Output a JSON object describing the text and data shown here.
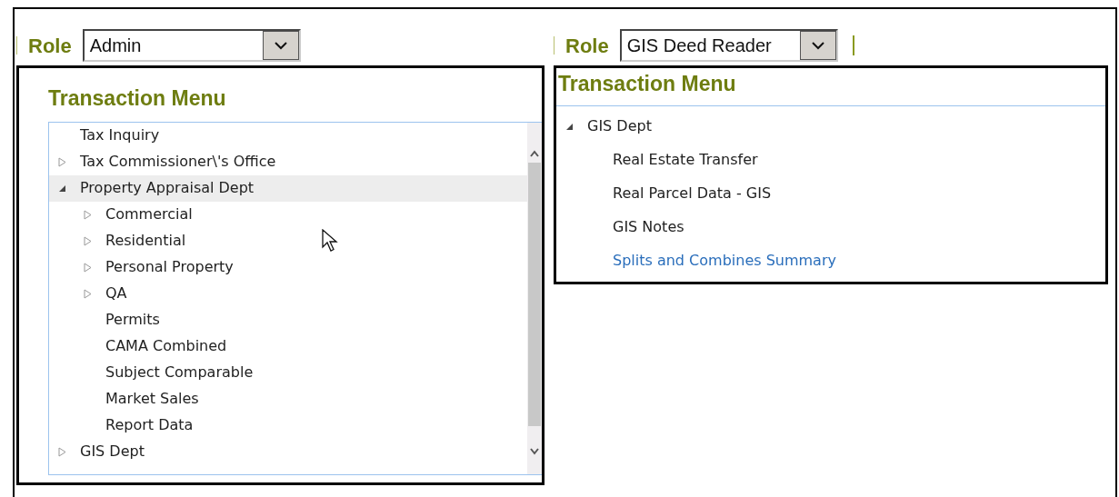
{
  "panels": [
    {
      "role": {
        "label": "Role",
        "value": "Admin"
      },
      "title": "Transaction Menu",
      "scrollbar": true,
      "items": [
        {
          "label": "Tax Inquiry",
          "kind": "leaf",
          "selected": false
        },
        {
          "label": "Tax Commissioner\\'s Office",
          "kind": "group",
          "expanded": false,
          "selected": false
        },
        {
          "label": "Property Appraisal Dept",
          "kind": "group",
          "expanded": true,
          "selected": true,
          "children": [
            {
              "label": "Commercial",
              "kind": "group",
              "expanded": false,
              "selected": false
            },
            {
              "label": "Residential",
              "kind": "group",
              "expanded": false,
              "selected": false
            },
            {
              "label": "Personal Property",
              "kind": "group",
              "expanded": false,
              "selected": false
            },
            {
              "label": "QA",
              "kind": "group",
              "expanded": false,
              "selected": false
            },
            {
              "label": "Permits",
              "kind": "leaf",
              "selected": false
            },
            {
              "label": "CAMA Combined",
              "kind": "leaf",
              "selected": false
            },
            {
              "label": "Subject Comparable",
              "kind": "leaf",
              "selected": false
            },
            {
              "label": "Market Sales",
              "kind": "leaf",
              "selected": false
            },
            {
              "label": "Report Data",
              "kind": "leaf",
              "selected": false
            }
          ]
        },
        {
          "label": "GIS Dept",
          "kind": "group",
          "expanded": false,
          "selected": false
        }
      ]
    },
    {
      "role": {
        "label": "Role",
        "value": "GIS Deed Reader"
      },
      "title": "Transaction Menu",
      "scrollbar": false,
      "items": [
        {
          "label": "GIS Dept",
          "kind": "group",
          "expanded": true,
          "selected": false,
          "children": [
            {
              "label": "Real Estate Transfer",
              "kind": "leaf",
              "selected": false
            },
            {
              "label": "Real Parcel Data - GIS",
              "kind": "leaf",
              "selected": false
            },
            {
              "label": "GIS Notes",
              "kind": "leaf",
              "selected": false
            },
            {
              "label": "Splits and Combines Summary",
              "kind": "link",
              "selected": false
            }
          ]
        }
      ]
    }
  ]
}
